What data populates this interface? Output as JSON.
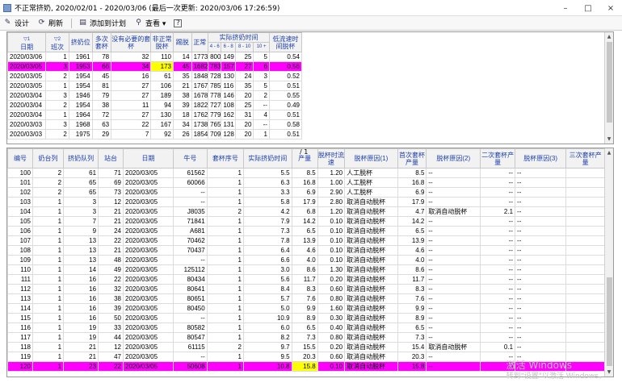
{
  "window": {
    "title": "不正常挤奶, 2020/02/01 - 2020/03/06 (最后一次更新: 2020/03/06 17:26:59)",
    "controls": [
      "–",
      "□",
      "×"
    ]
  },
  "toolbar": [
    {
      "icon": "design-icon",
      "glyph": "✎",
      "label": "设计"
    },
    {
      "icon": "refresh-icon",
      "glyph": "⟳",
      "label": "刷新"
    },
    {
      "icon": "plan-icon",
      "glyph": "▤",
      "label": "添加到计划"
    },
    {
      "icon": "view-icon",
      "glyph": "⚲",
      "label": "查看 ▾"
    },
    {
      "icon": "help-icon",
      "glyph": "?",
      "label": ""
    }
  ],
  "summary": {
    "headers": [
      "日期",
      "班次",
      "挤奶位",
      "多次套杯",
      "没有必要的套杯",
      "非正常脱杯",
      "踢脱",
      "正常",
      "4 - 6",
      "6 - 8",
      "8 - 10",
      "10 +",
      "低流速时间脱杯"
    ],
    "group_header": "实际挤奶时间",
    "sort": [
      "▽1",
      "▽2"
    ],
    "rows": [
      [
        "2020/03/06",
        "1",
        "1961",
        "78",
        "32",
        "110",
        "14",
        "1773",
        "800",
        "149",
        "25",
        "5",
        "0.54"
      ],
      [
        "2020/03/05",
        "3",
        "1953",
        "66",
        "34",
        "173",
        "45",
        "1682",
        "783",
        "157",
        "27",
        "6",
        "0.56"
      ],
      [
        "2020/03/05",
        "2",
        "1954",
        "45",
        "16",
        "61",
        "35",
        "1848",
        "728",
        "130",
        "24",
        "3",
        "0.52"
      ],
      [
        "2020/03/05",
        "1",
        "1954",
        "81",
        "27",
        "106",
        "21",
        "1767",
        "785",
        "116",
        "35",
        "5",
        "0.51"
      ],
      [
        "2020/03/04",
        "3",
        "1946",
        "79",
        "27",
        "189",
        "38",
        "1678",
        "778",
        "146",
        "20",
        "2",
        "0.55"
      ],
      [
        "2020/03/04",
        "2",
        "1954",
        "38",
        "11",
        "94",
        "39",
        "1822",
        "727",
        "108",
        "25",
        "--",
        "0.49"
      ],
      [
        "2020/03/04",
        "1",
        "1964",
        "72",
        "27",
        "130",
        "18",
        "1762",
        "779",
        "162",
        "31",
        "4",
        "0.51"
      ],
      [
        "2020/03/03",
        "3",
        "1968",
        "63",
        "22",
        "167",
        "34",
        "1738",
        "765",
        "131",
        "20",
        "--",
        "0.58"
      ],
      [
        "2020/03/03",
        "2",
        "1975",
        "29",
        "7",
        "92",
        "26",
        "1854",
        "709",
        "128",
        "20",
        "1",
        "0.51"
      ]
    ],
    "highlight_row": 1
  },
  "detail": {
    "page_marker": "/ 1",
    "headers": [
      "编号",
      "奶台列",
      "挤奶队列",
      "站台",
      "日期",
      "牛号",
      "套杯序号",
      "实际挤奶时间",
      "产量",
      "脱杯时流速",
      "脱杯原因(1)",
      "首次套杯产量",
      "脱杯原因(2)",
      "二次套杯产量",
      "脱杯原因(3)",
      "三次套杯产量"
    ],
    "rows": [
      [
        "100",
        "2",
        "61",
        "71",
        "2020/03/05",
        "61562",
        "1",
        "5.5",
        "8.5",
        "1.20",
        "人工脱杯",
        "8.5",
        "--",
        "--",
        "--",
        ""
      ],
      [
        "101",
        "2",
        "65",
        "69",
        "2020/03/05",
        "60066",
        "1",
        "6.3",
        "16.8",
        "1.00",
        "人工脱杯",
        "16.8",
        "--",
        "--",
        "--",
        ""
      ],
      [
        "102",
        "2",
        "65",
        "73",
        "2020/03/05",
        "--",
        "1",
        "3.3",
        "6.9",
        "2.90",
        "人工脱杯",
        "6.9",
        "--",
        "--",
        "--",
        ""
      ],
      [
        "103",
        "1",
        "3",
        "12",
        "2020/03/05",
        "--",
        "1",
        "5.8",
        "17.9",
        "2.80",
        "取消自动脱杯",
        "17.9",
        "--",
        "--",
        "--",
        ""
      ],
      [
        "104",
        "1",
        "3",
        "21",
        "2020/03/05",
        "J8035",
        "2",
        "4.2",
        "6.8",
        "1.20",
        "取消自动脱杯",
        "4.7",
        "取消自动脱杯",
        "2.1",
        "--",
        ""
      ],
      [
        "105",
        "1",
        "7",
        "21",
        "2020/03/05",
        "71841",
        "1",
        "7.9",
        "14.2",
        "0.10",
        "取消自动脱杯",
        "14.2",
        "--",
        "--",
        "--",
        ""
      ],
      [
        "106",
        "1",
        "9",
        "24",
        "2020/03/05",
        "A681",
        "1",
        "7.3",
        "6.5",
        "0.10",
        "取消自动脱杯",
        "6.5",
        "--",
        "--",
        "--",
        ""
      ],
      [
        "107",
        "1",
        "13",
        "22",
        "2020/03/05",
        "70462",
        "1",
        "7.8",
        "13.9",
        "0.10",
        "取消自动脱杯",
        "13.9",
        "--",
        "--",
        "--",
        ""
      ],
      [
        "108",
        "1",
        "13",
        "21",
        "2020/03/05",
        "70437",
        "1",
        "6.4",
        "4.6",
        "0.10",
        "取消自动脱杯",
        "4.6",
        "--",
        "--",
        "--",
        ""
      ],
      [
        "109",
        "1",
        "13",
        "48",
        "2020/03/05",
        "--",
        "1",
        "6.6",
        "4.0",
        "0.10",
        "取消自动脱杯",
        "4.0",
        "--",
        "--",
        "--",
        ""
      ],
      [
        "110",
        "1",
        "14",
        "49",
        "2020/03/05",
        "125112",
        "1",
        "3.0",
        "8.6",
        "1.30",
        "取消自动脱杯",
        "8.6",
        "--",
        "--",
        "--",
        ""
      ],
      [
        "111",
        "1",
        "16",
        "22",
        "2020/03/05",
        "80434",
        "1",
        "5.6",
        "11.7",
        "0.20",
        "取消自动脱杯",
        "11.7",
        "--",
        "--",
        "--",
        ""
      ],
      [
        "112",
        "1",
        "16",
        "32",
        "2020/03/05",
        "80641",
        "1",
        "8.4",
        "8.3",
        "0.60",
        "取消自动脱杯",
        "8.3",
        "--",
        "--",
        "--",
        ""
      ],
      [
        "113",
        "1",
        "16",
        "38",
        "2020/03/05",
        "80651",
        "1",
        "5.7",
        "7.6",
        "0.80",
        "取消自动脱杯",
        "7.6",
        "--",
        "--",
        "--",
        ""
      ],
      [
        "114",
        "1",
        "16",
        "39",
        "2020/03/05",
        "80450",
        "1",
        "5.0",
        "9.9",
        "1.60",
        "取消自动脱杯",
        "9.9",
        "--",
        "--",
        "--",
        ""
      ],
      [
        "115",
        "1",
        "16",
        "50",
        "2020/03/05",
        "--",
        "1",
        "10.9",
        "8.9",
        "0.30",
        "取消自动脱杯",
        "8.9",
        "--",
        "--",
        "--",
        ""
      ],
      [
        "116",
        "1",
        "19",
        "33",
        "2020/03/05",
        "80582",
        "1",
        "6.0",
        "6.5",
        "0.40",
        "取消自动脱杯",
        "6.5",
        "--",
        "--",
        "--",
        ""
      ],
      [
        "117",
        "1",
        "19",
        "44",
        "2020/03/05",
        "80547",
        "1",
        "8.2",
        "7.3",
        "0.80",
        "取消自动脱杯",
        "7.3",
        "--",
        "--",
        "--",
        ""
      ],
      [
        "118",
        "1",
        "21",
        "12",
        "2020/03/05",
        "61115",
        "2",
        "9.7",
        "15.5",
        "0.20",
        "取消自动脱杯",
        "15.4",
        "取消自动脱杯",
        "0.1",
        "--",
        ""
      ],
      [
        "119",
        "1",
        "21",
        "47",
        "2020/03/05",
        "--",
        "1",
        "9.5",
        "20.3",
        "0.60",
        "取消自动脱杯",
        "20.3",
        "--",
        "--",
        "--",
        ""
      ],
      [
        "120",
        "1",
        "23",
        "22",
        "2020/03/05",
        "50608",
        "1",
        "10.8",
        "15.8",
        "0.10",
        "取消自动脱杯",
        "15.8",
        "--",
        "--",
        "--",
        ""
      ]
    ],
    "highlight_row": 20
  },
  "watermark": {
    "line1": "激活 Windows",
    "line2": "转到\"设置\"以激活 Windows。"
  },
  "colors": {
    "highlight": "#ff00ff",
    "yellow": "#ffff00",
    "header_text": "#1d3fae"
  }
}
